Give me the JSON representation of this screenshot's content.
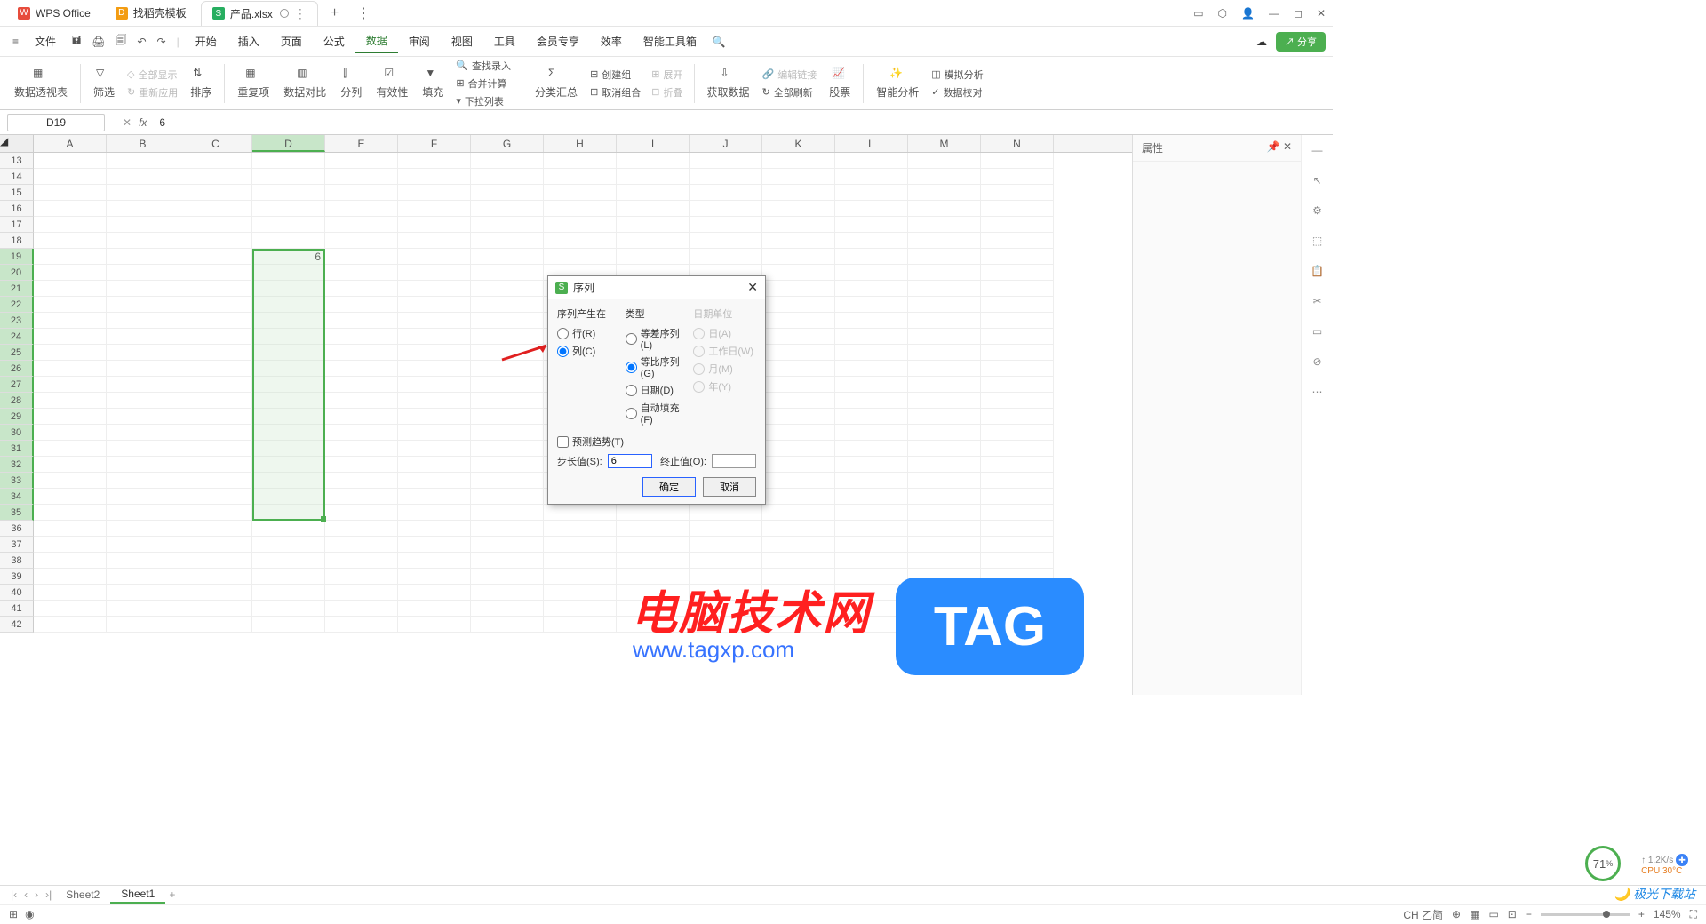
{
  "titlebar": {
    "tab1": "WPS Office",
    "tab2": "找稻壳模板",
    "tab3": "产品.xlsx"
  },
  "menubar": {
    "file": "文件",
    "items": [
      "开始",
      "插入",
      "页面",
      "公式",
      "数据",
      "审阅",
      "视图",
      "工具",
      "会员专享",
      "效率",
      "智能工具箱"
    ],
    "active_index": 4,
    "share": "分享"
  },
  "ribbon": {
    "pivot": "数据透视表",
    "filter": "筛选",
    "show_all": "全部显示",
    "reapply": "重新应用",
    "sort": "排序",
    "duplicates": "重复项",
    "data_compare": "数据对比",
    "split_col": "分列",
    "validity": "有效性",
    "fill": "填充",
    "find_input": "查找录入",
    "merge_calc": "合并计算",
    "dropdown": "下拉列表",
    "subtotal": "分类汇总",
    "group": "创建组",
    "ungroup": "取消组合",
    "expand": "展开",
    "collapse": "折叠",
    "get_data": "获取数据",
    "edit_link": "编辑链接",
    "refresh_all": "全部刷新",
    "stocks": "股票",
    "smart_analysis": "智能分析",
    "simulate": "模拟分析",
    "data_recheck": "数据校对"
  },
  "formula": {
    "cell_ref": "D19",
    "value": "6"
  },
  "columns": [
    "A",
    "B",
    "C",
    "D",
    "E",
    "F",
    "G",
    "H",
    "I",
    "J",
    "K",
    "L",
    "M",
    "N"
  ],
  "rows_start": 13,
  "rows_end": 42,
  "cell_d19": "6",
  "side_panel": {
    "title": "属性",
    "pin_icon": "📌",
    "close_icon": "✕"
  },
  "dialog": {
    "title": "序列",
    "section1": "序列产生在",
    "row_opt": "行(R)",
    "col_opt": "列(C)",
    "section2": "类型",
    "arith": "等差序列(L)",
    "geom": "等比序列(G)",
    "date_opt": "日期(D)",
    "autofill": "自动填充(F)",
    "section3": "日期单位",
    "day": "日(A)",
    "workday": "工作日(W)",
    "month": "月(M)",
    "year": "年(Y)",
    "predict": "预测趋势(T)",
    "step_label": "步长值(S):",
    "step_value": "6",
    "stop_label": "终止值(O):",
    "ok": "确定",
    "cancel": "取消"
  },
  "watermark": {
    "text": "电脑技术网",
    "url": "www.tagxp.com",
    "tag": "TAG"
  },
  "sheets": {
    "s1": "Sheet2",
    "s2": "Sheet1"
  },
  "status": {
    "zoom": "145%",
    "perf": "71",
    "net": "1.2K/s",
    "cpu": "CPU 30°C",
    "ime": "CH 乙简",
    "logo": "极光下载站"
  }
}
